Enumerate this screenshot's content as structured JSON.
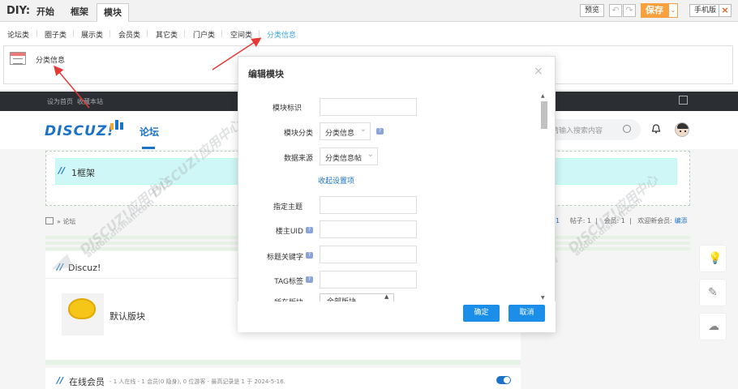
{
  "diy": {
    "label": "DIY:",
    "tabs": [
      {
        "label": "开始"
      },
      {
        "label": "框架"
      },
      {
        "label": "模块"
      }
    ],
    "buttons": {
      "preview": "预览",
      "undo": "↶",
      "redo": "↷",
      "save": "保存",
      "save_dropdown": "⌄",
      "mobile": "手机版",
      "close": "×"
    },
    "categories": [
      {
        "label": "论坛类"
      },
      {
        "label": "圈子类"
      },
      {
        "label": "展示类"
      },
      {
        "label": "会员类"
      },
      {
        "label": "其它类"
      },
      {
        "label": "门户类"
      },
      {
        "label": "空间类"
      },
      {
        "label": "分类信息"
      }
    ],
    "active_category": "分类信息",
    "module_item": {
      "label": "分类信息"
    }
  },
  "site": {
    "topnav": {
      "set_home": "设为首页",
      "bookmark": "收藏本站"
    },
    "logo_text": "DISCUZ!",
    "nav_forum": "论坛",
    "search_placeholder": "请输入搜索内容",
    "frame_label": "1框架",
    "breadcrumb": "» 论坛",
    "stats": {
      "posts_partial": "1",
      "threads": "帖子: 1",
      "members": "会员: 1",
      "welcome_prefix": "欢迎新会员:",
      "new_member": "编添"
    },
    "block_title": "Discuz!",
    "forum_name": "默认版块",
    "online": {
      "title": "在线会员",
      "info": "- 1 人在线 - 1 会员(0 隐身), 0 位游客 - 最高记录是 1 于 2024-5-16."
    }
  },
  "modal": {
    "title": "编辑模块",
    "close": "×",
    "fields": {
      "block_id": {
        "label": "模块标识",
        "value": ""
      },
      "block_category": {
        "label": "模块分类",
        "value": "分类信息"
      },
      "data_source": {
        "label": "数据来源",
        "value": "分类信息帖"
      },
      "collapse_link": "收起设置项",
      "topic": {
        "label": "指定主题",
        "value": ""
      },
      "owner_uid": {
        "label": "楼主UID",
        "value": ""
      },
      "title_keyword": {
        "label": "标题关键字",
        "value": ""
      },
      "tag": {
        "label": "TAG标签",
        "value": ""
      },
      "forum": {
        "label": "所在版块",
        "option": "全部版块"
      }
    },
    "ok": "确定",
    "cancel": "取消"
  },
  "colors": {
    "accent": "#1a8ee8",
    "save": "#f6a13e",
    "frame_bg": "#cff7f7",
    "annotation": "#e53935"
  },
  "icons": [
    "module-icon",
    "search-icon",
    "bell-icon",
    "avatar",
    "lightbulb-icon",
    "edit-icon",
    "wechat-icon",
    "home-icon"
  ]
}
